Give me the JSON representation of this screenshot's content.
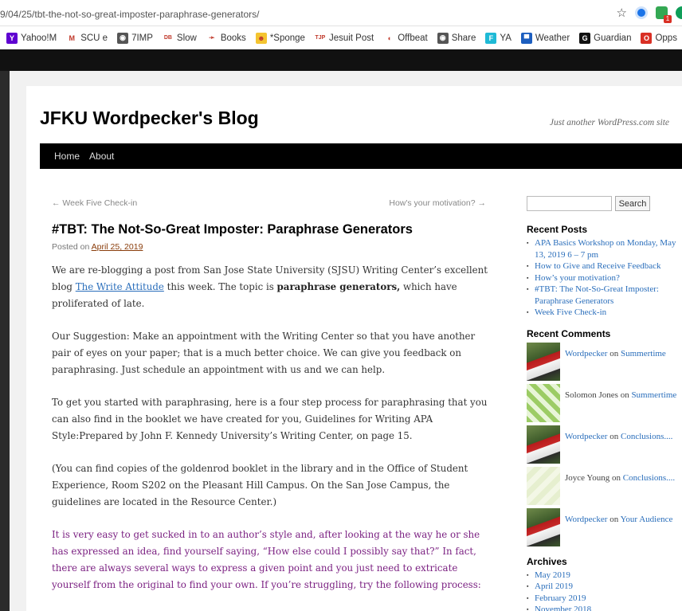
{
  "browser": {
    "url": "9/04/25/tbt-the-not-so-great-imposter-paraphrase-generators/",
    "badge_count": "1",
    "bookmarks": [
      {
        "label": "Yahoo!M",
        "icon": "yahoo-icon",
        "color": "#5f01d1",
        "glyph": "Y"
      },
      {
        "label": "SCU e",
        "icon": "gmail-icon",
        "color": "#ffffff",
        "glyph": "M"
      },
      {
        "label": "7IMP",
        "icon": "globe-icon",
        "color": "#555555",
        "glyph": "◉"
      },
      {
        "label": "Slow",
        "icon": "db-icon",
        "color": "#ffffff",
        "glyph": "DB"
      },
      {
        "label": "Books",
        "icon": "plane-icon",
        "color": "#ffffff",
        "glyph": "➛"
      },
      {
        "label": "*Sponge",
        "icon": "sponge-icon",
        "color": "#f4c430",
        "glyph": "☻"
      },
      {
        "label": "Jesuit Post",
        "icon": "tjp-icon",
        "color": "#ffffff",
        "glyph": "TJP"
      },
      {
        "label": "Offbeat",
        "icon": "pacman-icon",
        "color": "#ffffff",
        "glyph": "◖"
      },
      {
        "label": "Share",
        "icon": "globe-icon",
        "color": "#555555",
        "glyph": "◉"
      },
      {
        "label": "YA",
        "icon": "f-icon",
        "color": "#1fbad6",
        "glyph": "F"
      },
      {
        "label": "Weather",
        "icon": "weather-icon",
        "color": "#1c5ebf",
        "glyph": "▀"
      },
      {
        "label": "Guardian",
        "icon": "guardian-icon",
        "color": "#111111",
        "glyph": "G"
      },
      {
        "label": "Opps",
        "icon": "opps-icon",
        "color": "#d93025",
        "glyph": "O"
      }
    ]
  },
  "site": {
    "title": "JFKU Wordpecker's Blog",
    "description": "Just another WordPress.com site",
    "nav": [
      "Home",
      "About"
    ]
  },
  "post": {
    "prev": "← Week Five Check-in",
    "next": "How's your motivation? →",
    "title": "#TBT: The Not-So-Great Imposter: Paraphrase Generators",
    "posted_prefix": "Posted on ",
    "posted_date": "April 25, 2019",
    "p1_a": "We are re-blogging a post from San Jose State University (SJSU) Writing Center’s excellent blog ",
    "p1_link": "The Write Attitude",
    "p1_b": " this week. The topic is ",
    "p1_bold": "paraphrase generators,",
    "p1_c": " which have proliferated of late.",
    "p2": "Our Suggestion: Make an appointment with the Writing Center so that you have another pair of eyes on your paper; that is a much better choice. We can give you feedback on paraphrasing. Just schedule an appointment with us and we can help.",
    "p3": "To get you started with paraphrasing, here is a four step process for paraphrasing that you can also find in the booklet we have created for you, Guidelines for Writing APA Style:Prepared by John F. Kennedy University’s Writing Center, on page 15.",
    "p4": "(You can find copies of the goldenrod booklet in the library and in the Office of Student Experience, Room S202 on the Pleasant Hill Campus. On the San Jose Campus, the guidelines are located in the Resource Center.)",
    "p5": "It is very easy to get sucked in to an author’s style and, after looking at the way he or she has expressed an idea, find yourself saying, “How else could I possibly say that?”  In fact, there are always several ways to express a given point and you just need to extricate yourself from the original to find your own. If you’re struggling, try the following process:"
  },
  "sidebar": {
    "search_button": "Search",
    "recent_posts_title": "Recent Posts",
    "recent_posts": [
      "APA Basics Workshop on Monday, May 13, 2019 6 – 7 pm",
      "How to Give and Receive Feedback",
      "How’s your motivation?",
      "#TBT: The Not-So-Great Imposter: Paraphrase Generators",
      "Week Five Check-in"
    ],
    "recent_comments_title": "Recent Comments",
    "recent_comments": [
      {
        "author": "Wordpecker",
        "on": " on ",
        "post": "Summertime",
        "avatar": "bird"
      },
      {
        "author": "Solomon Jones",
        "on": " on ",
        "post": "Summertime",
        "avatar": "green"
      },
      {
        "author": "Wordpecker",
        "on": " on ",
        "post": "Conclusions....",
        "avatar": "bird"
      },
      {
        "author": "Joyce Young",
        "on": " on ",
        "post": "Conclusions....",
        "avatar": "pale"
      },
      {
        "author": "Wordpecker",
        "on": " on ",
        "post": "Your Audience",
        "avatar": "bird"
      }
    ],
    "archives_title": "Archives",
    "archives": [
      "May 2019",
      "April 2019",
      "February 2019",
      "November 2018"
    ]
  }
}
